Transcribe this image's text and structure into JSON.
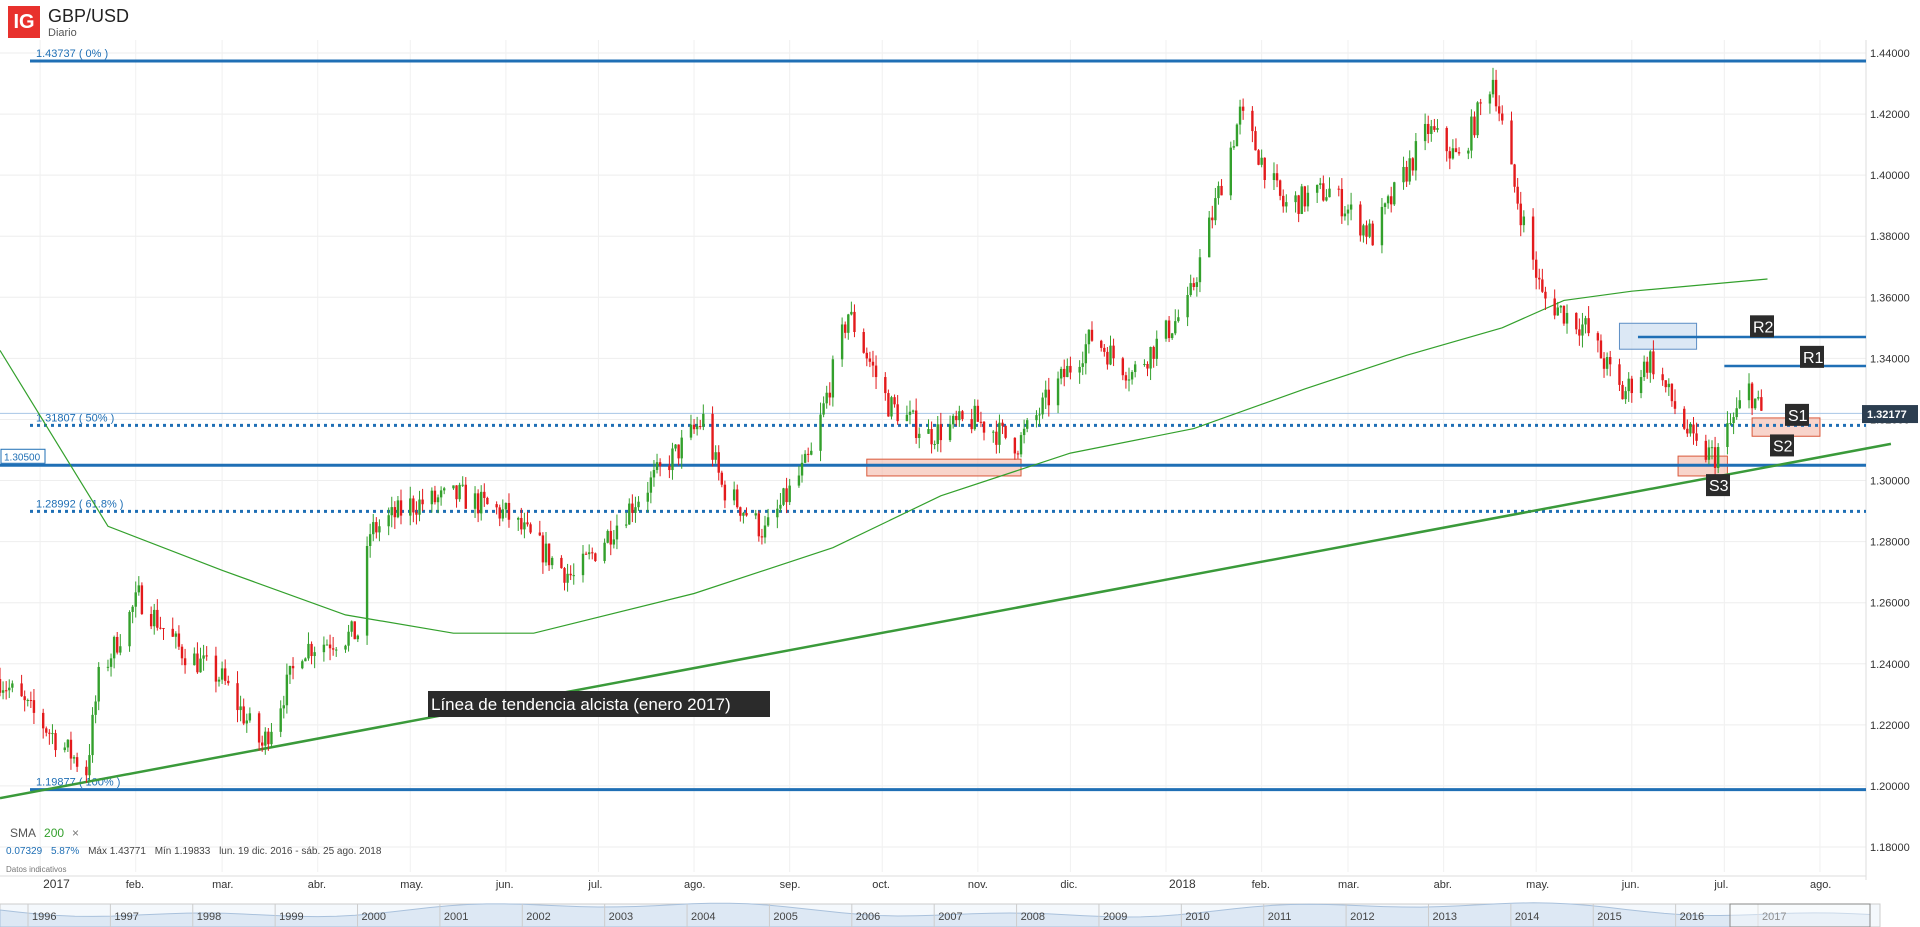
{
  "header": {
    "logo_text": "IG",
    "symbol": "GBP/USD",
    "interval": "Diario"
  },
  "indicator": {
    "name": "SMA",
    "period": "200",
    "close_glyph": "×"
  },
  "stats": {
    "change": "0.07329",
    "change_pct": "5.87%",
    "max_label": "Máx 1.43771",
    "min_label": "Mín 1.19833",
    "range_label": "lun. 19 dic. 2016 - sáb. 25 ago. 2018",
    "indicative": "Datos indicativos"
  },
  "colors": {
    "up": "#33a02c",
    "down": "#e31a1c",
    "level": "#1f6fb5",
    "sma": "#33a02c",
    "trendline": "#3a9a3a",
    "support_box": "#f4b8a8",
    "resistance_box": "#c5d9ee"
  },
  "chart_data": {
    "type": "candlestick",
    "title": "GBP/USD",
    "subtitle": "Diario",
    "y_ticks": [
      "1.44000",
      "1.42000",
      "1.40000",
      "1.38000",
      "1.36000",
      "1.34000",
      "1.32000",
      "1.30000",
      "1.28000",
      "1.26000",
      "1.24000",
      "1.22000",
      "1.20000",
      "1.18000"
    ],
    "ylim": [
      1.18,
      1.44
    ],
    "x_ticks": [
      "2017",
      "feb.",
      "mar.",
      "abr.",
      "may.",
      "jun.",
      "jul.",
      "ago.",
      "sep.",
      "oct.",
      "nov.",
      "dic.",
      "2018",
      "feb.",
      "mar.",
      "abr.",
      "may.",
      "jun.",
      "jul.",
      "ago."
    ],
    "xlim": [
      "2016-12-19",
      "2018-08-25"
    ],
    "current_price": "1.32177",
    "close_path": [
      [
        "2016-12-19",
        1.235
      ],
      [
        "2017-01-16",
        1.205
      ],
      [
        "2017-01-20",
        1.235
      ],
      [
        "2017-02-02",
        1.262
      ],
      [
        "2017-02-15",
        1.245
      ],
      [
        "2017-03-01",
        1.235
      ],
      [
        "2017-03-14",
        1.213
      ],
      [
        "2017-03-27",
        1.245
      ],
      [
        "2017-04-14",
        1.25
      ],
      [
        "2017-04-18",
        1.283
      ],
      [
        "2017-05-01",
        1.292
      ],
      [
        "2017-05-17",
        1.295
      ],
      [
        "2017-06-01",
        1.289
      ],
      [
        "2017-06-15",
        1.275
      ],
      [
        "2017-06-23",
        1.268
      ],
      [
        "2017-07-10",
        1.29
      ],
      [
        "2017-07-27",
        1.31
      ],
      [
        "2017-08-04",
        1.32
      ],
      [
        "2017-08-10",
        1.298
      ],
      [
        "2017-08-24",
        1.283
      ],
      [
        "2017-09-08",
        1.308
      ],
      [
        "2017-09-20",
        1.355
      ],
      [
        "2017-10-03",
        1.325
      ],
      [
        "2017-10-16",
        1.315
      ],
      [
        "2017-10-31",
        1.32
      ],
      [
        "2017-11-14",
        1.312
      ],
      [
        "2017-11-28",
        1.333
      ],
      [
        "2017-12-08",
        1.347
      ],
      [
        "2017-12-21",
        1.335
      ],
      [
        "2018-01-08",
        1.357
      ],
      [
        "2018-01-25",
        1.42
      ],
      [
        "2018-02-08",
        1.39
      ],
      [
        "2018-02-23",
        1.395
      ],
      [
        "2018-03-09",
        1.38
      ],
      [
        "2018-03-27",
        1.415
      ],
      [
        "2018-04-06",
        1.405
      ],
      [
        "2018-04-17",
        1.432
      ],
      [
        "2018-04-23",
        1.4
      ],
      [
        "2018-05-03",
        1.36
      ],
      [
        "2018-05-17",
        1.35
      ],
      [
        "2018-05-29",
        1.328
      ],
      [
        "2018-06-07",
        1.34
      ],
      [
        "2018-06-22",
        1.31
      ],
      [
        "2018-06-28",
        1.308
      ],
      [
        "2018-07-09",
        1.33
      ],
      [
        "2018-07-13",
        1.322
      ]
    ],
    "sma200_path": [
      [
        "2016-12-19",
        1.3426
      ],
      [
        "2017-01-23",
        1.285
      ],
      [
        "2017-03-01",
        1.2706
      ],
      [
        "2017-04-10",
        1.256
      ],
      [
        "2017-05-15",
        1.25
      ],
      [
        "2017-06-10",
        1.25
      ],
      [
        "2017-08-01",
        1.263
      ],
      [
        "2017-09-15",
        1.278
      ],
      [
        "2017-10-20",
        1.295
      ],
      [
        "2017-12-01",
        1.309
      ],
      [
        "2018-01-10",
        1.317
      ],
      [
        "2018-02-15",
        1.33
      ],
      [
        "2018-03-20",
        1.341
      ],
      [
        "2018-04-20",
        1.35
      ],
      [
        "2018-05-10",
        1.359
      ],
      [
        "2018-06-01",
        1.362
      ],
      [
        "2018-07-15",
        1.366
      ]
    ],
    "fibonacci_levels": [
      {
        "label": "1.43737 ( 0% )",
        "value": 1.43737,
        "style": "solid"
      },
      {
        "label": "1.31807 ( 50% )",
        "value": 1.31807,
        "style": "dotted"
      },
      {
        "label": "1.28992 ( 61.8% )",
        "value": 1.28992,
        "style": "dotted"
      },
      {
        "label": "1.19877 ( 100% )",
        "value": 1.19877,
        "style": "solid"
      }
    ],
    "horizontal_levels": [
      {
        "label": "1.30500",
        "value": 1.305,
        "style": "solid"
      }
    ],
    "trendline": {
      "label": "Línea de tendencia alcista (enero 2017)",
      "start": [
        "2016-12-19",
        1.196
      ],
      "end": [
        "2018-08-24",
        1.312
      ]
    },
    "annotations": [
      {
        "label": "R2",
        "value": 1.347,
        "from": "2018-06-03"
      },
      {
        "label": "R1",
        "value": 1.3375,
        "from": "2018-07-01"
      },
      {
        "label": "S1",
        "value": 1.318,
        "from": "2018-07-10"
      },
      {
        "label": "S2",
        "value": 1.309,
        "from": "2018-07-10"
      },
      {
        "label": "S3",
        "value": 1.302,
        "from": "2018-06-16"
      }
    ],
    "zones": [
      {
        "kind": "support",
        "start": "2017-09-26",
        "end": "2017-11-15",
        "low": 1.3015,
        "high": 1.307
      },
      {
        "kind": "resistance",
        "start": "2018-05-28",
        "end": "2018-06-22",
        "low": 1.343,
        "high": 1.3515
      },
      {
        "kind": "support",
        "start": "2018-06-16",
        "end": "2018-07-02",
        "low": 1.3015,
        "high": 1.308
      },
      {
        "kind": "support",
        "start": "2018-07-10",
        "end": "2018-08-01",
        "low": 1.3145,
        "high": 1.3205
      }
    ],
    "navigator": {
      "years": [
        "1996",
        "1997",
        "1998",
        "1999",
        "2000",
        "2001",
        "2002",
        "2003",
        "2004",
        "2005",
        "2006",
        "2007",
        "2008",
        "2009",
        "2010",
        "2011",
        "2012",
        "2013",
        "2014",
        "2015",
        "2016",
        "2017"
      ]
    },
    "grid": true
  }
}
